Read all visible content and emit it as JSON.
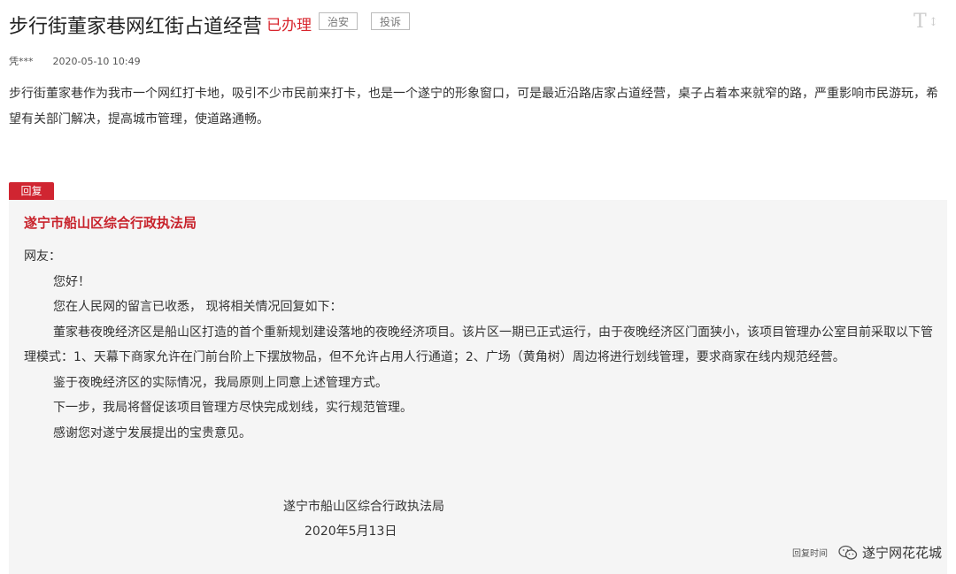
{
  "post": {
    "title": "步行街董家巷网红街占道经营",
    "status": "已办理",
    "tags": [
      "治安",
      "投诉"
    ],
    "author": "凭***",
    "time": "2020-05-10 10:49",
    "content": "步行街董家巷作为我市一个网红打卡地，吸引不少市民前来打卡，也是一个遂宁的形象窗口，可是最近沿路店家占道经营，桌子占着本来就窄的路，严重影响市民游玩，希望有关部门解决，提高城市管理，使道路通畅。"
  },
  "font_toggle": {
    "label": "T",
    "arrow": "↕"
  },
  "reply": {
    "badge": "回复",
    "org": "遂宁市船山区综合行政执法局",
    "paragraphs": [
      "网友：",
      "您好！",
      "您在人民网的留言已收悉， 现将相关情况回复如下：",
      "董家巷夜晚经济区是船山区打造的首个重新规划建设落地的夜晚经济项目。该片区一期已正式运行，由于夜晚经济区门面狭小，该项目管理办公室目前采取以下管理模式：1、天幕下商家允许在门前台阶上下摆放物品，但不允许占用人行通道；2、广场（黄角树）周边将进行划线管理，要求商家在线内规范经营。",
      "鉴于夜晚经济区的实际情况，我局原则上同意上述管理方式。",
      "下一步，我局将督促该项目管理方尽快完成划线，实行规范管理。",
      "感谢您对遂宁发展提出的宝贵意见。"
    ],
    "signature_org": "遂宁市船山区综合行政执法局",
    "signature_date": "2020年5月13日",
    "reply_time_label": "回复时间"
  },
  "watermark": {
    "text": "遂宁网花花城",
    "icon": "wechat-icon"
  },
  "colors": {
    "accent": "#d02531",
    "reply_bg": "#f5f5f5"
  }
}
